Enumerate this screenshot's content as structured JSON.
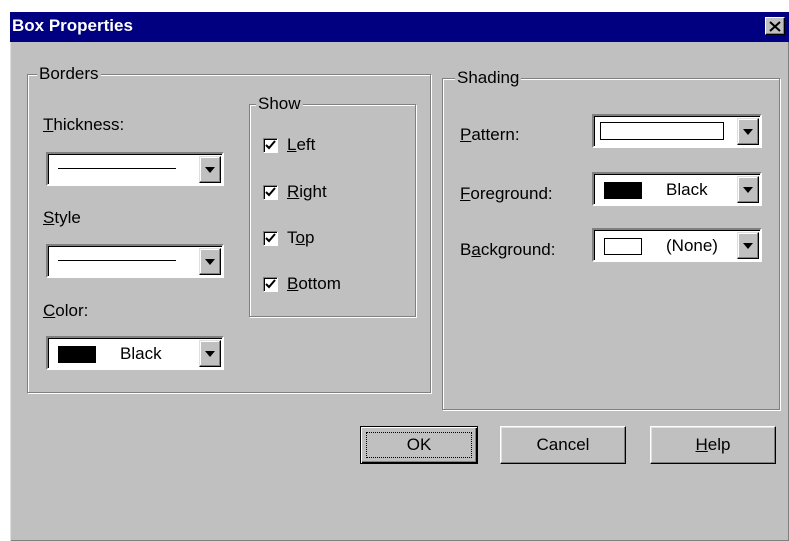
{
  "window": {
    "title": "Box Properties",
    "close_glyph": "✕"
  },
  "borders": {
    "legend": "Borders",
    "thickness_label": "Thickness:",
    "style_label": "Style",
    "color_label": "Color:",
    "color_value": "Black"
  },
  "show": {
    "legend": "Show",
    "items": [
      {
        "label": "Left",
        "checked": true
      },
      {
        "label": "Right",
        "checked": true
      },
      {
        "label": "Top",
        "checked": true
      },
      {
        "label": "Bottom",
        "checked": true
      }
    ]
  },
  "shading": {
    "legend": "Shading",
    "pattern_label": "Pattern:",
    "foreground_label": "Foreground:",
    "foreground_value": "Black",
    "background_label": "Background:",
    "background_value": "(None)"
  },
  "buttons": {
    "ok": "OK",
    "cancel": "Cancel",
    "help": "Help"
  },
  "colors": {
    "titlebar": "#000080",
    "face": "#c0c0c0",
    "swatch_black": "#000000",
    "swatch_none": "#ffffff"
  }
}
